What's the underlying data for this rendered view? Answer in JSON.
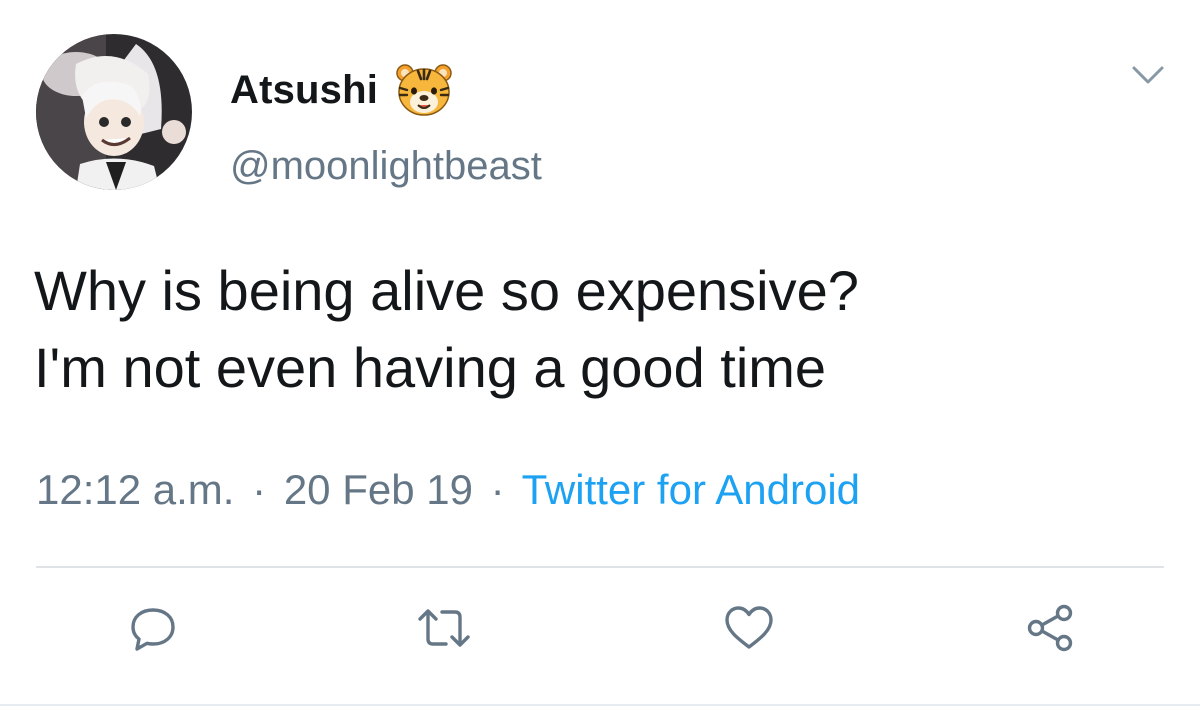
{
  "user": {
    "display_name": "Atsushi",
    "handle": "@moonlightbeast",
    "badge_icon": "tiger-face-emoji"
  },
  "tweet": {
    "lines": [
      "Why is being alive so expensive?",
      "I'm not even having a good time"
    ]
  },
  "meta": {
    "time": "12:12 a.m.",
    "separator": "·",
    "date": "20 Feb 19",
    "source": "Twitter for Android"
  },
  "actions": [
    {
      "icon": "reply-icon"
    },
    {
      "icon": "retweet-icon"
    },
    {
      "icon": "like-icon"
    },
    {
      "icon": "share-icon"
    }
  ],
  "colors": {
    "text": "#14171a",
    "secondary": "#657786",
    "link": "#1da1f2",
    "icon": "#657786",
    "divider": "#dfe3e6"
  }
}
